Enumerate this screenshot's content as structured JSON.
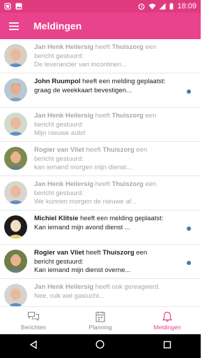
{
  "status_bar": {
    "time": "18:09"
  },
  "app_bar": {
    "title": "Meldingen"
  },
  "notifications": [
    {
      "sender": "Jan Henk Heilersig",
      "middle": " heeft ",
      "target": "Thuiszorg",
      "tail": " een",
      "line2": "bericht gestuurd:",
      "line3": "De leverancier van incontinen...",
      "state": "read"
    },
    {
      "sender": "John Ruumpol",
      "middle": " heeft een melding geplaatst:",
      "target": "",
      "tail": "",
      "line2": "graag de weekkaart bevestigen...",
      "line3": "",
      "state": "unread"
    },
    {
      "sender": "Jan Henk Heilersig",
      "middle": " heeft ",
      "target": "Thuiszorg",
      "tail": " een",
      "line2": "bericht gestuurd:",
      "line3": "Mijn nieuwe auto!",
      "state": "read"
    },
    {
      "sender": "Rogier van Vliet",
      "middle": " heeft ",
      "target": "Thuiszorg",
      "tail": " een",
      "line2": "bericht gestuurd:",
      "line3": "kan iemand morgen mijn dienst...",
      "state": "read"
    },
    {
      "sender": "Jan Henk Heilersig",
      "middle": " heeft ",
      "target": "Thuiszorg",
      "tail": " een",
      "line2": "bericht gestuurd:",
      "line3": "We kunnen morgen de nieuwe af...",
      "state": "read"
    },
    {
      "sender": "Michiel Klitsie",
      "middle": " heeft een melding geplaatst:",
      "target": "",
      "tail": "",
      "line2": "Kan iemand mijn avond dienst ...",
      "line3": "",
      "state": "unread"
    },
    {
      "sender": "Rogier van Vliet",
      "middle": " heeft ",
      "target": "Thuiszorg",
      "tail": " een",
      "line2": "bericht gestuurd:",
      "line3": "Kan iemand mijn dienst overne...",
      "state": "unread"
    },
    {
      "sender": "Jan Henk Heilersig",
      "middle": " heeft ook gereageerd.",
      "target": "",
      "tail": "",
      "line2": "Nee, ruik wel gasiucht...",
      "line3": "",
      "state": "read"
    }
  ],
  "bottom_nav": [
    {
      "label": "Berichten",
      "icon": "chat-bubbles-icon"
    },
    {
      "label": "Planning",
      "icon": "calendar-icon"
    },
    {
      "label": "Meldingen",
      "icon": "bell-icon",
      "active": true
    }
  ],
  "colors": {
    "accent": "#e8438c",
    "status_bar": "#e03a7f",
    "unread_dot": "#3d7ab3"
  }
}
